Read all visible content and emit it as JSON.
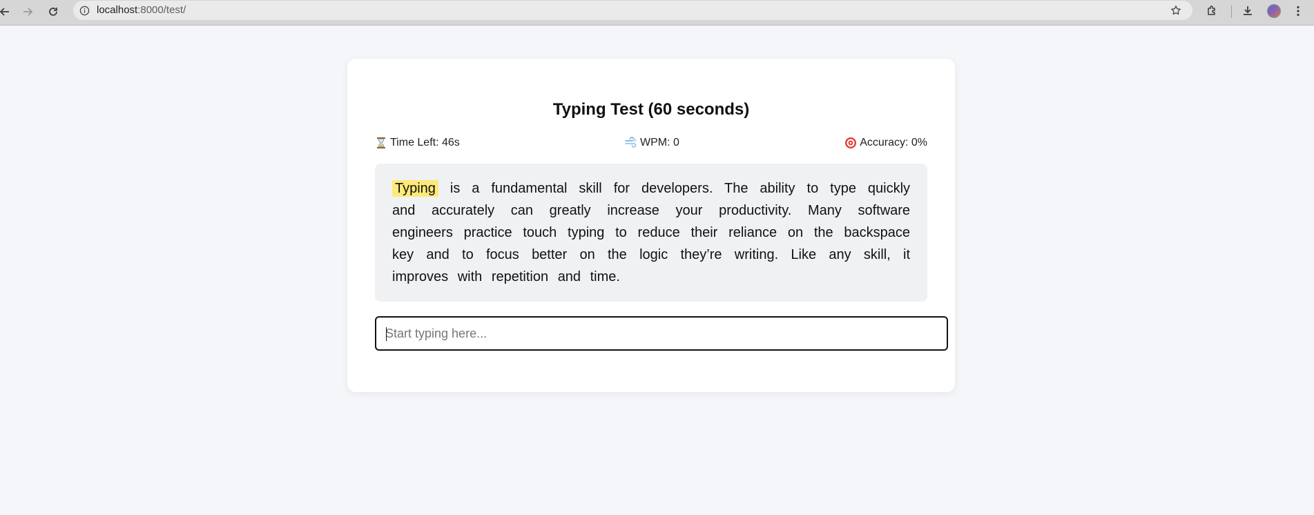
{
  "browser": {
    "url_host": "localhost",
    "url_path": ":8000/test/"
  },
  "test": {
    "title": "Typing Test (60 seconds)",
    "stats": {
      "time_left": "Time Left: 46s",
      "wpm": "WPM: 0",
      "accuracy": "Accuracy: 0%"
    },
    "stat_icons": {
      "time": "hourglass-icon",
      "wpm": "dash-wind-icon",
      "accuracy": "target-icon"
    },
    "current_word_index": 0,
    "highlight_color": "#fde979",
    "passage_words": [
      "Typing",
      "is",
      "a",
      "fundamental",
      "skill",
      "for",
      "developers.",
      "The",
      "ability",
      "to",
      "type",
      "quickly",
      "and",
      "accurately",
      "can",
      "greatly",
      "increase",
      "your",
      "productivity.",
      "Many",
      "software",
      "engineers",
      "practice",
      "touch",
      "typing",
      "to",
      "reduce",
      "their",
      "reliance",
      "on",
      "the",
      "backspace",
      "key",
      "and",
      "to",
      "focus",
      "better",
      "on",
      "the",
      "logic",
      "they’re",
      "writing.",
      "Like",
      "any",
      "skill,",
      "it",
      "improves",
      "with",
      "repetition",
      "and",
      "time."
    ],
    "input": {
      "placeholder": "Start typing here...",
      "value": ""
    }
  }
}
